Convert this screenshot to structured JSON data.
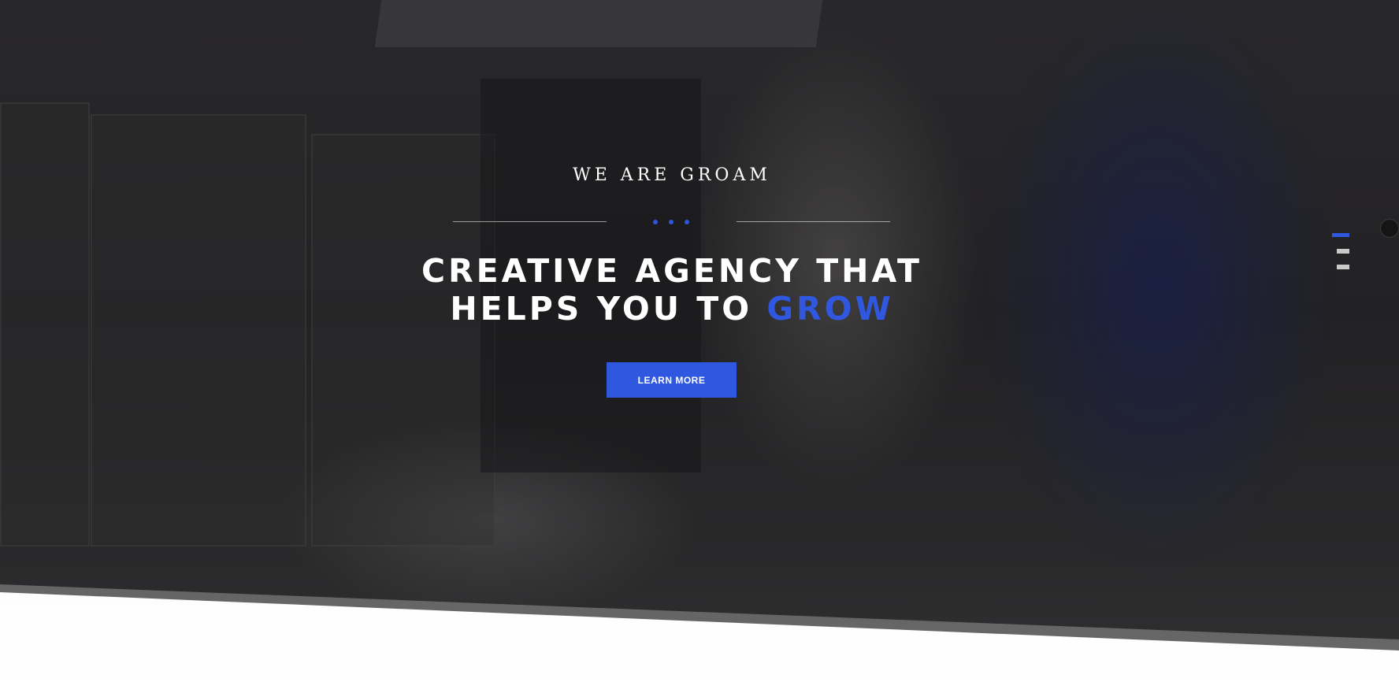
{
  "hero": {
    "kicker": "WE ARE GROAM",
    "headline_line1": "CREATIVE AGENCY THAT",
    "headline_line2_prefix": "HELPS YOU TO",
    "headline_accent": "GROW",
    "cta_label": "LEARN MORE"
  },
  "icons": {
    "divider": "three-dots-icon",
    "menu": "hamburger-menu-icon",
    "side_nav": "circle-nav-icon"
  },
  "colors": {
    "accent": "#2f57e0",
    "text": "#ffffff",
    "overlay": "#2b2a2a"
  }
}
